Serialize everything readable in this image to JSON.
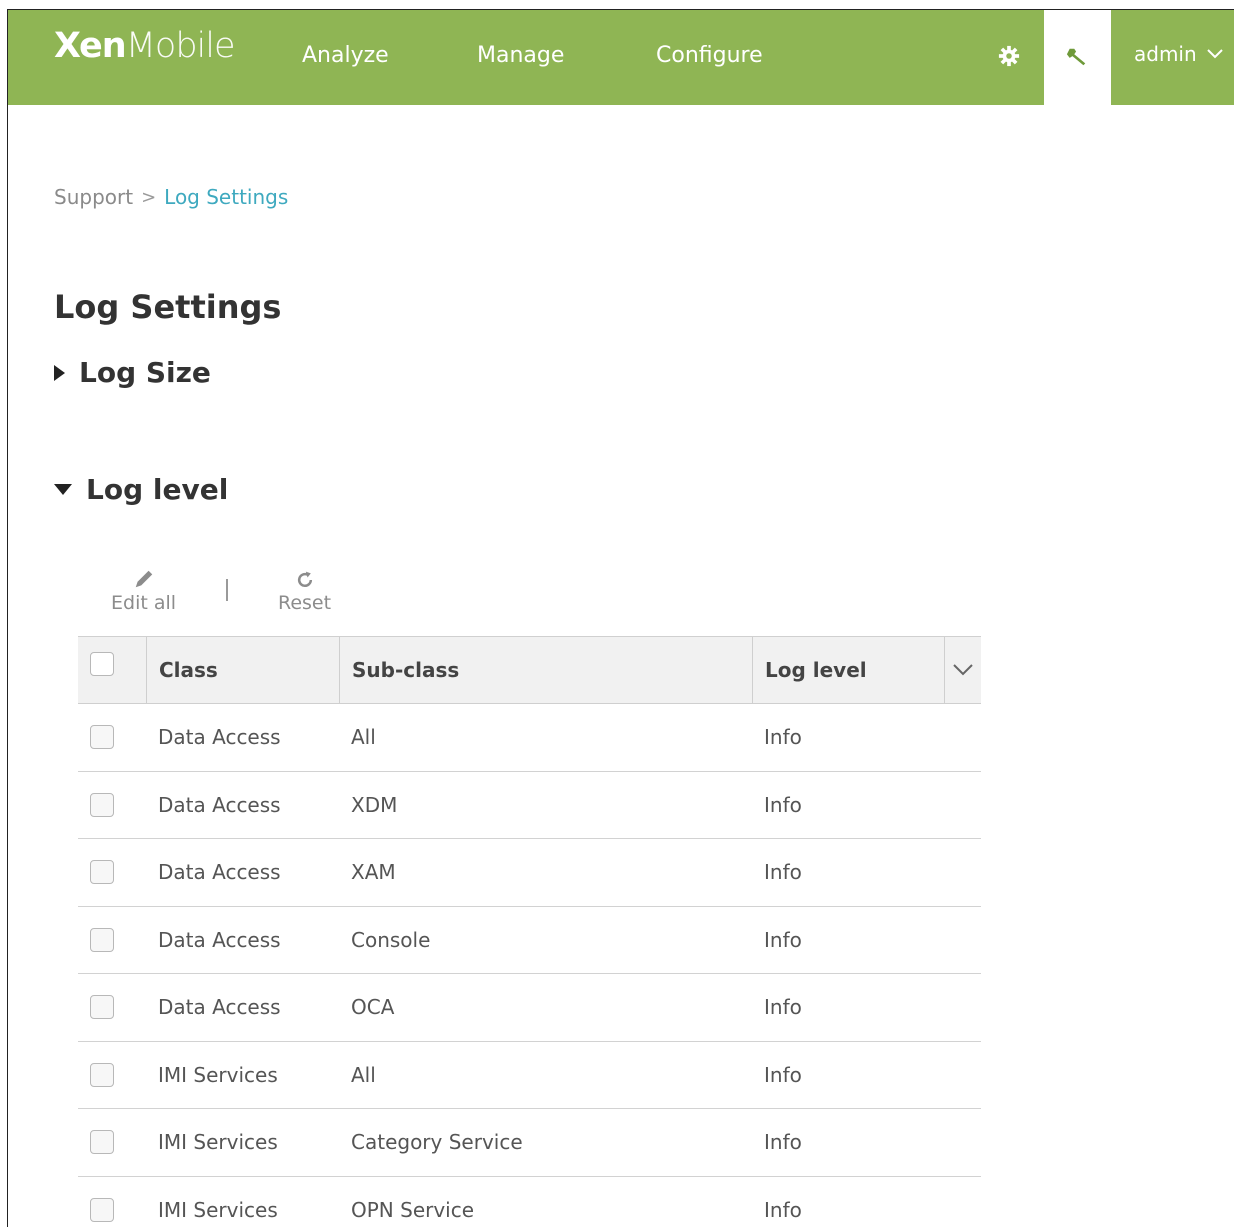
{
  "header": {
    "brand_bold": "Xen",
    "brand_thin": "Mobile",
    "nav": [
      "Analyze",
      "Manage",
      "Configure"
    ],
    "settings_icon": "gear-icon",
    "support_icon": "wrench-icon",
    "user": "admin"
  },
  "breadcrumb": {
    "parent": "Support",
    "separator": ">",
    "current": "Log Settings"
  },
  "page": {
    "title": "Log Settings",
    "log_size_label": "Log Size",
    "log_level_label": "Log level"
  },
  "toolbar": {
    "edit_all": "Edit all",
    "reset": "Reset"
  },
  "table": {
    "columns": [
      "Class",
      "Sub-class",
      "Log level"
    ],
    "rows": [
      {
        "class": "Data Access",
        "subclass": "All",
        "level": "Info"
      },
      {
        "class": "Data Access",
        "subclass": "XDM",
        "level": "Info"
      },
      {
        "class": "Data Access",
        "subclass": "XAM",
        "level": "Info"
      },
      {
        "class": "Data Access",
        "subclass": "Console",
        "level": "Info"
      },
      {
        "class": "Data Access",
        "subclass": "OCA",
        "level": "Info"
      },
      {
        "class": "IMI Services",
        "subclass": "All",
        "level": "Info"
      },
      {
        "class": "IMI Services",
        "subclass": "Category Service",
        "level": "Info"
      },
      {
        "class": "IMI Services",
        "subclass": "OPN Service",
        "level": "Info"
      }
    ]
  },
  "colors": {
    "header_bg": "#8fb554",
    "link": "#3ea9bf"
  }
}
